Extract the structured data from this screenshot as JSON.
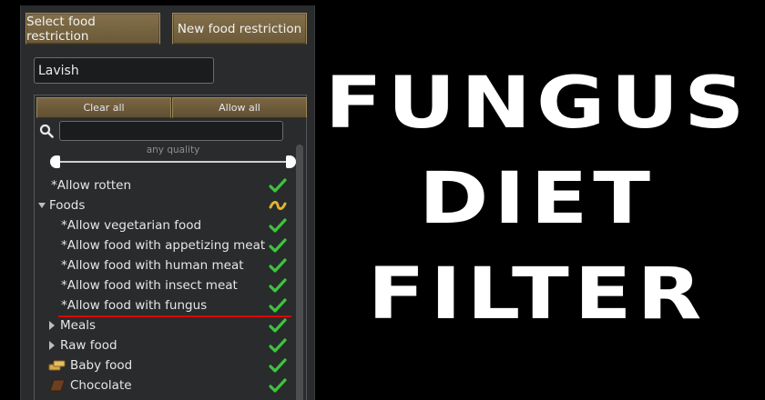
{
  "top_buttons": {
    "select": "Select food restriction",
    "new": "New food restriction"
  },
  "restriction_name": "Lavish",
  "filter": {
    "clear_all": "Clear all",
    "allow_all": "Allow all",
    "search_value": "",
    "quality_label": "any quality"
  },
  "tree": {
    "allow_rotten": "*Allow rotten",
    "foods": "Foods",
    "vegetarian": "*Allow vegetarian food",
    "appetizing_meat": "*Allow food with appetizing meat",
    "human_meat": "*Allow food with human meat",
    "insect_meat": "*Allow food with insect meat",
    "fungus": "*Allow food with fungus",
    "meals": "Meals",
    "raw_food": "Raw food",
    "baby_food": "Baby food",
    "chocolate": "Chocolate"
  },
  "icons": {
    "check": "checkmark-icon",
    "partial": "partial-tilde-icon",
    "search": "search-icon"
  },
  "colors": {
    "check": "#3ec43e",
    "partial": "#e0b233",
    "highlight": "#e00000",
    "button": "#76633f"
  },
  "title": {
    "line1": "FUNGUS",
    "line2": "DIET",
    "line3": "FILTER"
  }
}
